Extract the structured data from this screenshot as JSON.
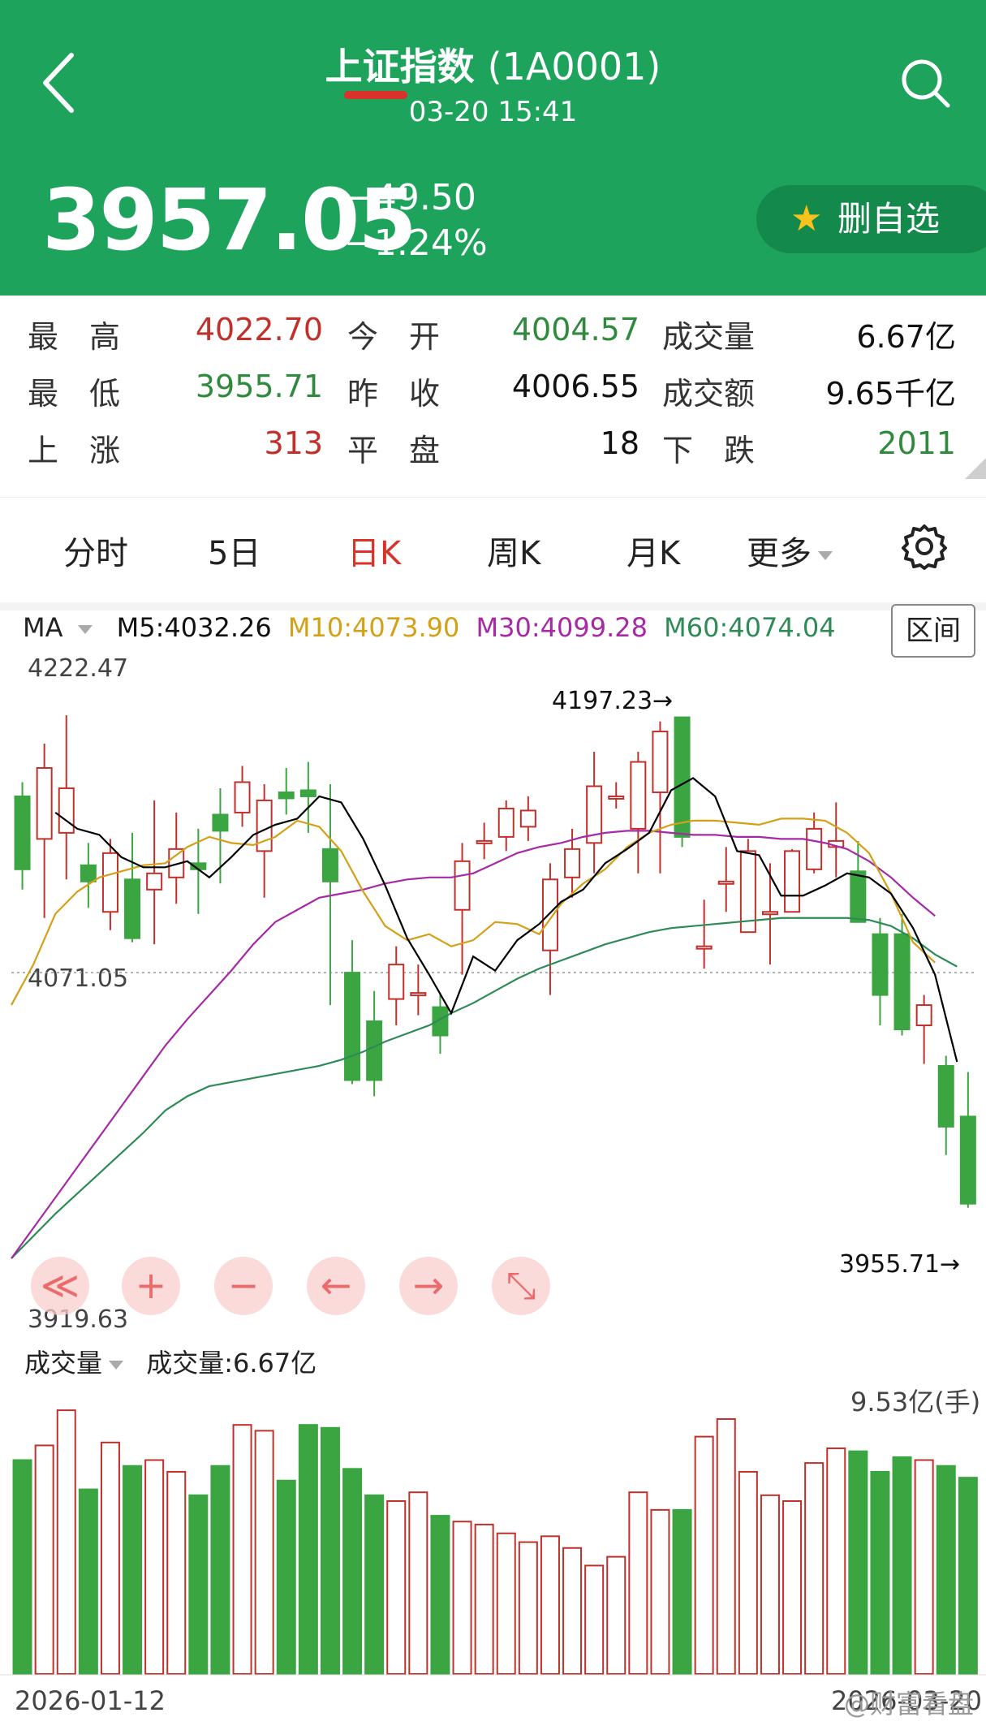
{
  "header": {
    "title": "上证指数",
    "code": "(1A0001)",
    "datetime": "03-20 15:41",
    "price": "3957.05",
    "change": "−49.50",
    "change_pct": "−1.24%",
    "watch_label": "删自选"
  },
  "stats": [
    {
      "label": "最　高",
      "value": "4022.70",
      "color": "red"
    },
    {
      "label": "今　开",
      "value": "4004.57",
      "color": "green"
    },
    {
      "label": "成交量",
      "value": "6.67亿",
      "color": "black"
    },
    {
      "label": "最　低",
      "value": "3955.71",
      "color": "green"
    },
    {
      "label": "昨　收",
      "value": "4006.55",
      "color": "black"
    },
    {
      "label": "成交额",
      "value": "9.65千亿",
      "color": "black"
    },
    {
      "label": "上　涨",
      "value": "313",
      "color": "red"
    },
    {
      "label": "平　盘",
      "value": "18",
      "color": "black"
    },
    {
      "label": "下　跌",
      "value": "2011",
      "color": "green"
    }
  ],
  "tabs": [
    "分时",
    "5日",
    "日K",
    "周K",
    "月K",
    "更多"
  ],
  "active_tab": "日K",
  "ma": {
    "label": "MA",
    "m5": "M5:4032.26",
    "m10": "M10:4073.90",
    "m30": "M30:4099.28",
    "m60": "M60:4074.04"
  },
  "range_button": "区间",
  "volume_header": {
    "label": "成交量",
    "value": "成交量:6.67亿",
    "max_label": "9.53亿(手)"
  },
  "controls": [
    "≪",
    "+",
    "−",
    "←",
    "→",
    "⤡"
  ],
  "watermark": "@财富看盘",
  "colors": {
    "up": "#c1302a",
    "down": "#3aa541",
    "m5": "#000000",
    "m10": "#d4a017",
    "m30": "#a629a6",
    "m60": "#2e8b57",
    "header": "#1ea35c"
  },
  "chart_data": {
    "type": "candlestick",
    "y_top_label": "4222.47",
    "y_bottom_label": "3919.63",
    "ylim": [
      3919.63,
      4222.47
    ],
    "ref_line": 4071.05,
    "ref_label": "4071.05",
    "high_marker": "4197.23→",
    "low_marker": "3955.71→",
    "x_start_label": "2026-01-12",
    "x_end_label": "2026-03-20",
    "candles": [
      {
        "o": 4158,
        "c": 4122,
        "h": 4165,
        "l": 4112
      },
      {
        "o": 4137,
        "c": 4172,
        "h": 4184,
        "l": 4098
      },
      {
        "o": 4140,
        "c": 4162,
        "h": 4198,
        "l": 4117
      },
      {
        "o": 4124,
        "c": 4116,
        "h": 4135,
        "l": 4103
      },
      {
        "o": 4101,
        "c": 4130,
        "h": 4137,
        "l": 4092
      },
      {
        "o": 4117,
        "c": 4088,
        "h": 4140,
        "l": 4086
      },
      {
        "o": 4112,
        "c": 4120,
        "h": 4156,
        "l": 4085
      },
      {
        "o": 4118,
        "c": 4132,
        "h": 4150,
        "l": 4105
      },
      {
        "o": 4125,
        "c": 4122,
        "h": 4142,
        "l": 4100
      },
      {
        "o": 4149,
        "c": 4141,
        "h": 4162,
        "l": 4115
      },
      {
        "o": 4150,
        "c": 4165,
        "h": 4173,
        "l": 4143
      },
      {
        "o": 4131,
        "c": 4156,
        "h": 4164,
        "l": 4108
      },
      {
        "o": 4160,
        "c": 4157,
        "h": 4172,
        "l": 4149
      },
      {
        "o": 4161,
        "c": 4158,
        "h": 4175,
        "l": 4140
      },
      {
        "o": 4132,
        "c": 4116,
        "h": 4164,
        "l": 4055
      },
      {
        "o": 4071,
        "c": 4018,
        "h": 4087,
        "l": 4016
      },
      {
        "o": 4047,
        "c": 4018,
        "h": 4062,
        "l": 4010
      },
      {
        "o": 4058,
        "c": 4075,
        "h": 4084,
        "l": 4045
      },
      {
        "o": 4061,
        "c": 4061,
        "h": 4075,
        "l": 4050
      },
      {
        "o": 4054,
        "c": 4040,
        "h": 4061,
        "l": 4031
      },
      {
        "o": 4102,
        "c": 4126,
        "h": 4135,
        "l": 4070
      },
      {
        "o": 4136,
        "c": 4136,
        "h": 4145,
        "l": 4127
      },
      {
        "o": 4138,
        "c": 4152,
        "h": 4156,
        "l": 4131
      },
      {
        "o": 4143,
        "c": 4151,
        "h": 4158,
        "l": 4136
      },
      {
        "o": 4082,
        "c": 4117,
        "h": 4125,
        "l": 4060
      },
      {
        "o": 4118,
        "c": 4132,
        "h": 4142,
        "l": 4108
      },
      {
        "o": 4135,
        "c": 4163,
        "h": 4180,
        "l": 4120
      },
      {
        "o": 4158,
        "c": 4158,
        "h": 4165,
        "l": 4152
      },
      {
        "o": 4142,
        "c": 4175,
        "h": 4180,
        "l": 4120
      },
      {
        "o": 4160,
        "c": 4190,
        "h": 4195,
        "l": 4120
      },
      {
        "o": 4197,
        "c": 4138,
        "h": 4197,
        "l": 4133
      },
      {
        "o": 4084,
        "c": 4084,
        "h": 4107,
        "l": 4073
      },
      {
        "o": 4116,
        "c": 4116,
        "h": 4133,
        "l": 4101
      },
      {
        "o": 4091,
        "c": 4131,
        "h": 4137,
        "l": 4091
      },
      {
        "o": 4101,
        "c": 4101,
        "h": 4125,
        "l": 4075
      },
      {
        "o": 4101,
        "c": 4131,
        "h": 4132,
        "l": 4101
      },
      {
        "o": 4122,
        "c": 4142,
        "h": 4150,
        "l": 4120
      },
      {
        "o": 4133,
        "c": 4136,
        "h": 4155,
        "l": 4118
      },
      {
        "o": 4121,
        "c": 4096,
        "h": 4136,
        "l": 4096
      },
      {
        "o": 4090,
        "c": 4060,
        "h": 4098,
        "l": 4045
      },
      {
        "o": 4090,
        "c": 4043,
        "h": 4100,
        "l": 4040
      },
      {
        "o": 4045,
        "c": 4055,
        "h": 4060,
        "l": 4026
      },
      {
        "o": 4025,
        "c": 3995,
        "h": 4030,
        "l": 3981
      },
      {
        "o": 4000,
        "c": 3957,
        "h": 4022,
        "l": 3955
      }
    ],
    "ma5": [
      4150,
      4142,
      4139,
      4128,
      4123,
      4123,
      4126,
      4118,
      4128,
      4139,
      4144,
      4147,
      4158,
      4155,
      4137,
      4114,
      4088,
      4070,
      4051,
      4079,
      4072,
      4087,
      4095,
      4106,
      4112,
      4125,
      4132,
      4140,
      4161,
      4167,
      4158,
      4131,
      4129,
      4109,
      4109,
      4114,
      4120,
      4118,
      4110,
      4093,
      4070,
      4027
    ],
    "ma10": [
      4055,
      4075,
      4100,
      4111,
      4118,
      4121,
      4124,
      4125,
      4133,
      4138,
      4135,
      4134,
      4138,
      4146,
      4143,
      4131,
      4111,
      4094,
      4087,
      4090,
      4084,
      4087,
      4096,
      4095,
      4090,
      4105,
      4115,
      4122,
      4133,
      4140,
      4144,
      4146,
      4146,
      4145,
      4144,
      4147,
      4147,
      4146,
      4140,
      4130,
      4110,
      4086,
      4076
    ],
    "m30": [
      3930,
      3945,
      3960,
      3975,
      3990,
      4005,
      4020,
      4035,
      4048,
      4060,
      4072,
      4085,
      4096,
      4102,
      4108,
      4110,
      4112,
      4115,
      4117,
      4118,
      4118,
      4120,
      4125,
      4130,
      4133,
      4135,
      4138,
      4140,
      4141,
      4141,
      4140,
      4139,
      4139,
      4138,
      4138,
      4137,
      4137,
      4135,
      4132,
      4126,
      4118,
      4108,
      4099
    ],
    "m60": [
      3930,
      3941,
      3952,
      3962,
      3972,
      3982,
      3992,
      4003,
      4010,
      4015,
      4017,
      4019,
      4021,
      4023,
      4025,
      4028,
      4032,
      4037,
      4041,
      4045,
      4051,
      4056,
      4062,
      4068,
      4073,
      4077,
      4081,
      4085,
      4088,
      4091,
      4093,
      4094,
      4095,
      4096,
      4097,
      4098,
      4098,
      4098,
      4098,
      4097,
      4094,
      4088,
      4080,
      4074
    ],
    "volumes": [
      0.73,
      0.78,
      0.9,
      0.63,
      0.79,
      0.71,
      0.73,
      0.69,
      0.61,
      0.71,
      0.85,
      0.83,
      0.66,
      0.85,
      0.84,
      0.7,
      0.61,
      0.59,
      0.62,
      0.54,
      0.52,
      0.51,
      0.48,
      0.45,
      0.47,
      0.43,
      0.37,
      0.4,
      0.62,
      0.56,
      0.56,
      0.81,
      0.87,
      0.69,
      0.61,
      0.59,
      0.72,
      0.77,
      0.76,
      0.69,
      0.74,
      0.73,
      0.71,
      0.67
    ],
    "volume_max": 0.953
  }
}
